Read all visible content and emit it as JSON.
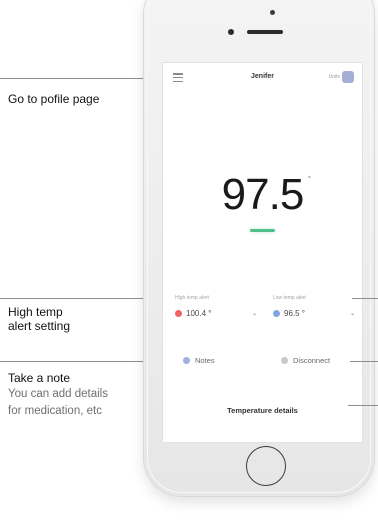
{
  "annotations": {
    "profile": "Go to pofile page",
    "high_temp_line1": "High temp",
    "high_temp_line2": "alert setting",
    "note_title": "Take a note",
    "note_line1": "You can add details",
    "note_line2": "for medication, etc"
  },
  "header": {
    "menu_icon": "hamburger-menu-icon",
    "user_name": "Jenifer",
    "toggle_label": "Units",
    "toggle_icon": "unit-toggle-icon"
  },
  "reading": {
    "value": "97.5",
    "unit": "°",
    "status_color": "#4fbf8b"
  },
  "alerts": {
    "high": {
      "label": "High temp alert",
      "value": "100.4 °",
      "color": "#f0635f"
    },
    "low": {
      "label": "Low temp alert",
      "value": "96.5 °",
      "color": "#7fa6de"
    },
    "chevron": "⌄"
  },
  "actions": {
    "notes_label": "Notes",
    "notes_color": "#9fb0e0",
    "disconnect_label": "Disconnect",
    "disconnect_color": "#c9c9c9"
  },
  "footer": {
    "details_label": "Temperature details"
  }
}
